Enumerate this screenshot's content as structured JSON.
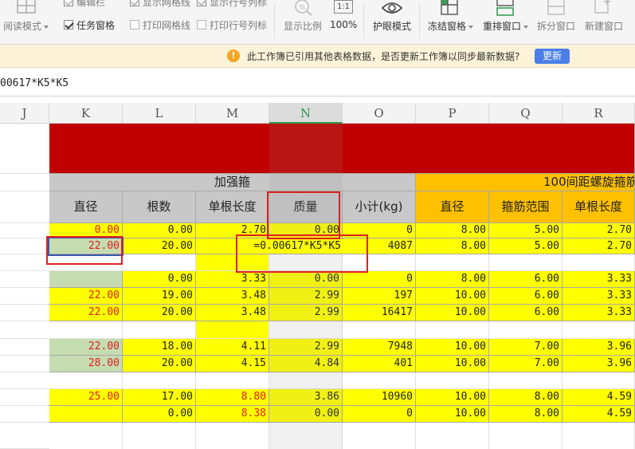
{
  "ribbon": {
    "reading_mode": "阅读模式",
    "edit_bar": "编辑栏",
    "task_pane": "任务窗格",
    "show_gridlines": "显示网格线",
    "print_gridlines": "打印网格线",
    "show_headers": "显示行号列标",
    "print_headers": "打印行号列标",
    "display_ratio": "显示比例",
    "zoom_value": "100%",
    "zoom_icon": "1:1",
    "eye_mode": "护眼模式",
    "freeze_panes": "冻结窗格",
    "rearrange_window": "重排窗口",
    "split_window": "拆分窗口",
    "new_window": "新建窗口",
    "checks": {
      "edit_bar": true,
      "task_pane": true,
      "show_gridlines": true,
      "print_gridlines": false,
      "show_headers": true,
      "print_headers": false
    }
  },
  "notice": {
    "text": "此工作簿已引用其他表格数据，是否更新工作簿以同步最新数据?",
    "button": "更新",
    "icon_glyph": "!"
  },
  "formula_bar": {
    "text": "00617*K5*K5"
  },
  "columns": [
    "J",
    "K",
    "L",
    "M",
    "N",
    "O",
    "P",
    "Q",
    "R"
  ],
  "selected_column": "N",
  "table": {
    "group1_title": "加强箍",
    "group2_title": "100间距螺旋箍筋",
    "headers": [
      "直径",
      "根数",
      "单根长度",
      "质量",
      "小计(kg)",
      "直径",
      "箍筋范围",
      "单根长度"
    ],
    "editing_formula": "=0.00617*K5*K5",
    "rows": [
      [
        "22.00",
        "20.00",
        "",
        "",
        "4087",
        "8.00",
        "5.00",
        "2.70"
      ],
      [
        "",
        "",
        "",
        "",
        "",
        "",
        "",
        ""
      ],
      [
        "",
        "0.00",
        "3.33",
        "0.00",
        "0",
        "8.00",
        "6.00",
        "3.33"
      ],
      [
        "22.00",
        "19.00",
        "3.48",
        "2.99",
        "197",
        "10.00",
        "6.00",
        "3.33"
      ],
      [
        "22.00",
        "20.00",
        "3.48",
        "2.99",
        "16417",
        "10.00",
        "6.00",
        "3.33"
      ],
      [
        "",
        "",
        "",
        "",
        "",
        "",
        "",
        ""
      ],
      [
        "22.00",
        "18.00",
        "4.11",
        "2.99",
        "7948",
        "10.00",
        "7.00",
        "3.96"
      ],
      [
        "28.00",
        "20.00",
        "4.15",
        "4.84",
        "401",
        "10.00",
        "7.00",
        "3.96"
      ],
      [
        "",
        "",
        "",
        "",
        "",
        "",
        "",
        ""
      ],
      [
        "25.00",
        "17.00",
        "8.80",
        "3.86",
        "10960",
        "10.00",
        "8.00",
        "4.59"
      ],
      [
        "",
        "0.00",
        "8.38",
        "0.00",
        "0",
        "10.00",
        "8.00",
        "4.59"
      ]
    ],
    "top_row": [
      "0.00",
      "0.00",
      "2.70",
      "0.00",
      "0",
      "8.00",
      "5.00",
      "2.70"
    ]
  },
  "colors": {
    "banner_red": "#c00000",
    "group1_gray": "#c8c8c8",
    "group2_orange": "#ffc000",
    "cell_yellow": "#ffff00",
    "cell_green": "#c5dbb0",
    "red_text": "#e02020",
    "highlight_red": "#e02020"
  }
}
